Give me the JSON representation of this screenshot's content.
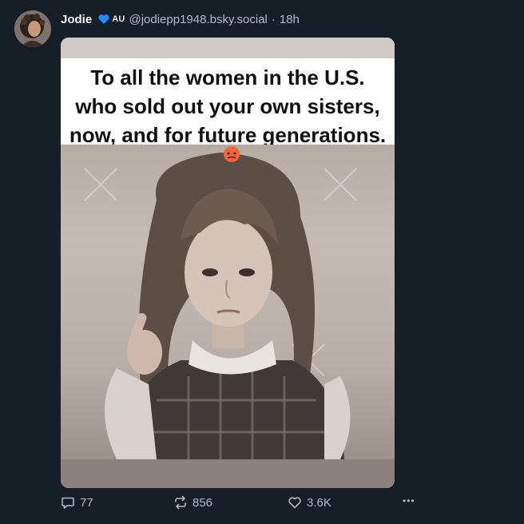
{
  "post": {
    "author": {
      "display_name": "Jodie",
      "badge": "AU",
      "handle": "@jodiepp1948.bsky.social",
      "separator": "·",
      "time": "18h"
    },
    "media": {
      "caption_lines": [
        "To all the women in the U.S.",
        "who sold out your own sisters,",
        "now, and for future generations."
      ],
      "emoji": "😡"
    },
    "actions": {
      "replies": "77",
      "reposts": "856",
      "likes": "3.6K",
      "more": "•••"
    }
  },
  "colors": {
    "background": "#161e27",
    "muted_text": "#aebbc9",
    "heart_badge": "#208bfe"
  }
}
